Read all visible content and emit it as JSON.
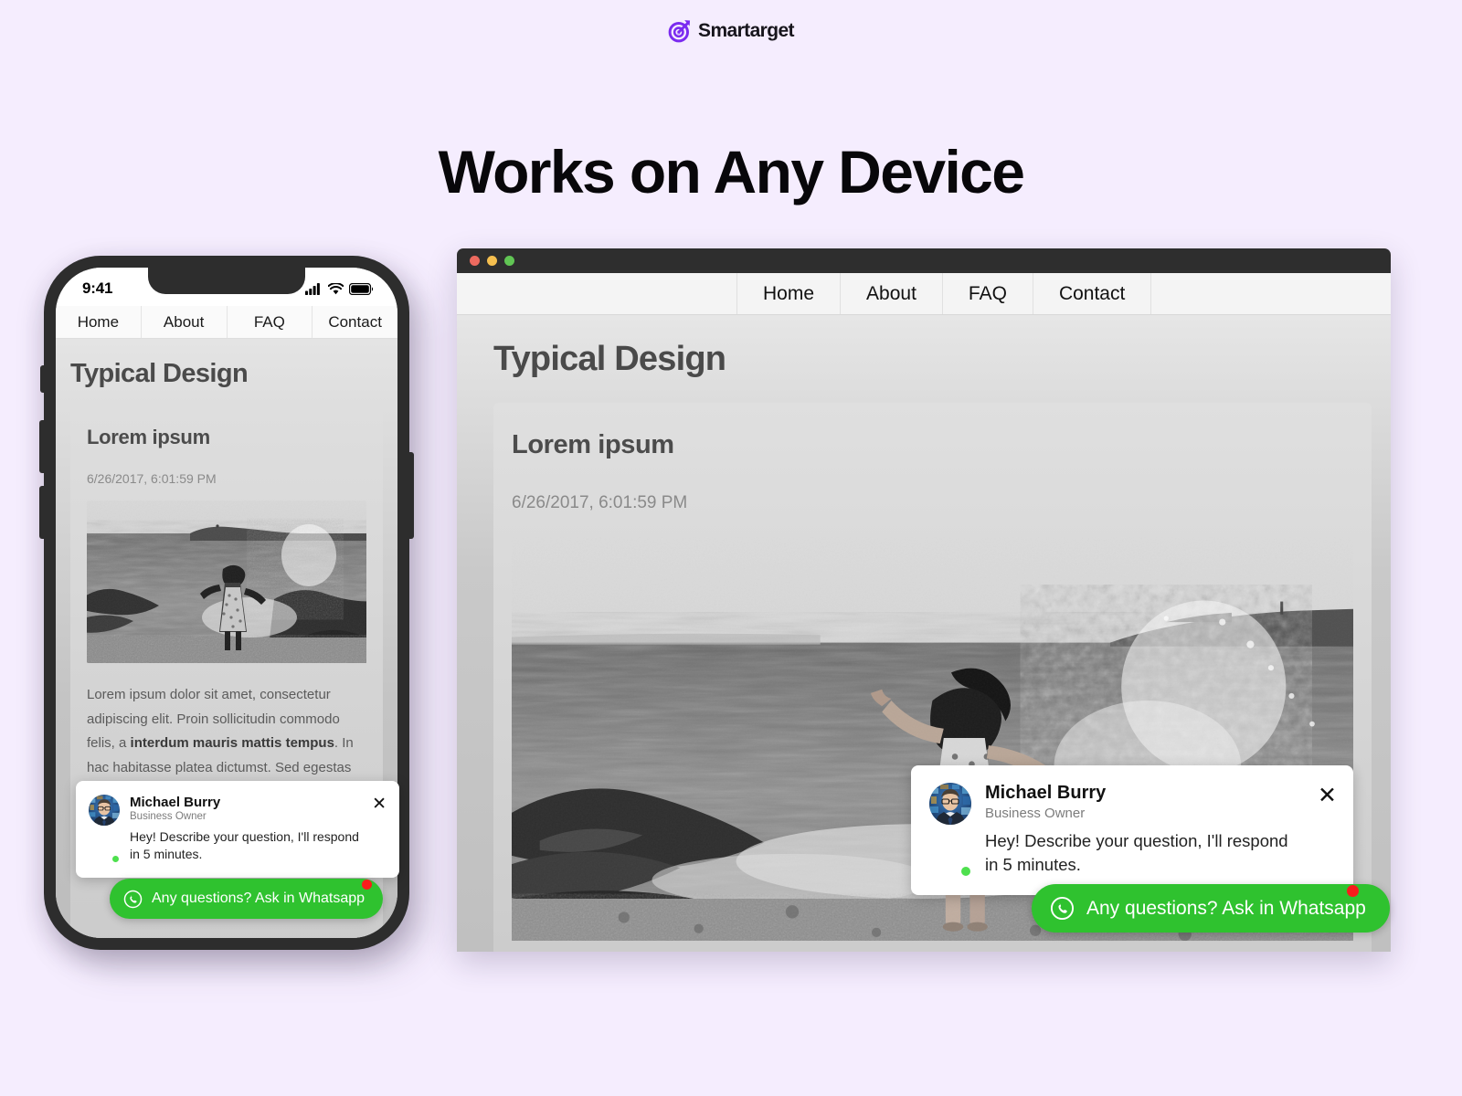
{
  "brand": {
    "name": "Smartarget",
    "logo_icon": "target-arrow-icon"
  },
  "headline": "Works on Any Device",
  "phone": {
    "status_bar": {
      "time": "9:41",
      "icons": [
        "cellular-signal-icon",
        "wifi-icon",
        "battery-icon"
      ]
    },
    "nav": [
      {
        "label": "Home"
      },
      {
        "label": "About"
      },
      {
        "label": "FAQ"
      },
      {
        "label": "Contact"
      }
    ],
    "page_title": "Typical Design",
    "card": {
      "title": "Lorem ipsum",
      "date": "6/26/2017, 6:01:59 PM",
      "photo_alt": "woman-on-rocky-beach-photo",
      "body_lead": "Lorem ipsum dolor sit amet, consectetur adipiscing elit. Proin sollicitudin commodo felis, a ",
      "body_bold": "interdum mauris mattis tempus",
      "body_tail": ". In hac habitasse platea dictumst. Sed egestas nibh ut magna tincidunt, quis nisl porta. Donec nec lacus vel nunc."
    }
  },
  "desktop": {
    "window_controls": [
      "close-red",
      "minimize-yellow",
      "maximize-green"
    ],
    "nav": [
      {
        "label": "Home"
      },
      {
        "label": "About"
      },
      {
        "label": "FAQ"
      },
      {
        "label": "Contact"
      }
    ],
    "page_title": "Typical Design",
    "card": {
      "title": "Lorem ipsum",
      "date": "6/26/2017, 6:01:59 PM",
      "photo_alt": "woman-on-rocky-beach-photo"
    }
  },
  "chat_widget": {
    "name": "Michael Burry",
    "role": "Business Owner",
    "message": "Hey! Describe your question, I'll respond in 5 minutes.",
    "close_glyph": "✕",
    "cta_label": "Any questions? Ask in Whatsapp",
    "cta_icon": "whatsapp-icon",
    "online": true
  },
  "colors": {
    "page_background": "#F5EDFE",
    "brand_purple": "#7B2BF0",
    "whatsapp_green": "#2FC22F",
    "badge_red": "#F81C1C",
    "online_green": "#4EE04E",
    "titlebar_dark": "#2E2E2E"
  }
}
